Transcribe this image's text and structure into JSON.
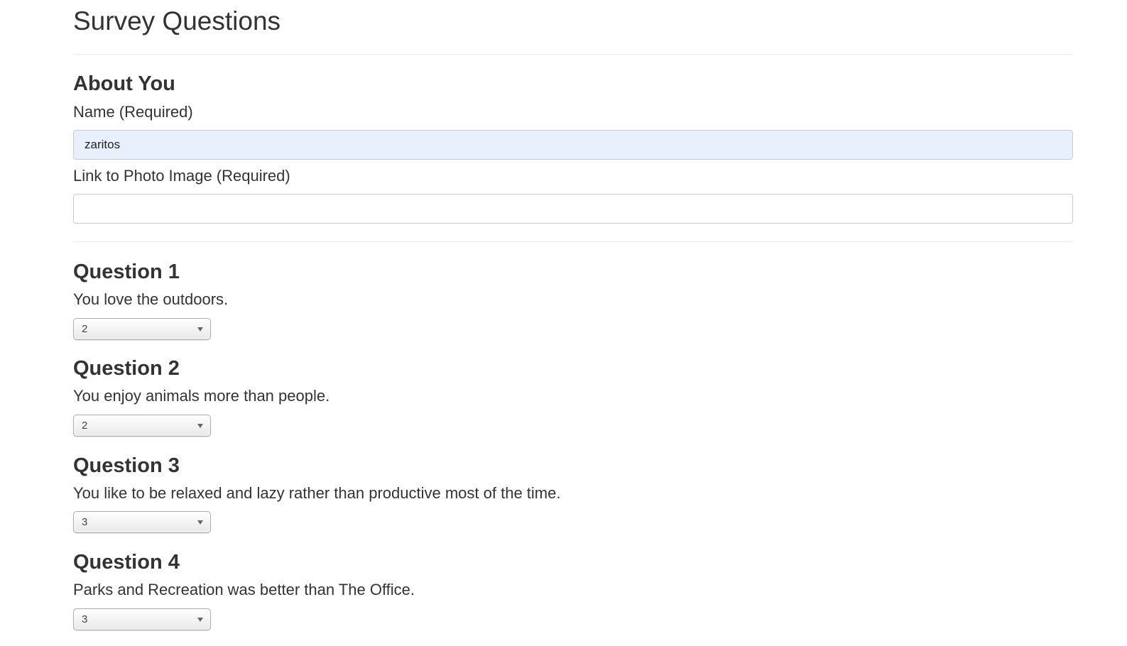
{
  "page": {
    "title": "Survey Questions"
  },
  "about": {
    "heading": "About You",
    "name_label": "Name (Required)",
    "name_value": "zaritos",
    "photo_label": "Link to Photo Image (Required)",
    "photo_value": ""
  },
  "questions": [
    {
      "heading": "Question 1",
      "text": "You love the outdoors.",
      "selected": "2"
    },
    {
      "heading": "Question 2",
      "text": "You enjoy animals more than people.",
      "selected": "2"
    },
    {
      "heading": "Question 3",
      "text": "You like to be relaxed and lazy rather than productive most of the time.",
      "selected": "3"
    },
    {
      "heading": "Question 4",
      "text": "Parks and Recreation was better than The Office.",
      "selected": "3"
    }
  ],
  "icons": {
    "dropdown": "chevron-down-icon"
  },
  "colors": {
    "autofill_background": "#e8f0fe",
    "text": "#333333",
    "divider": "#eeeeee"
  }
}
